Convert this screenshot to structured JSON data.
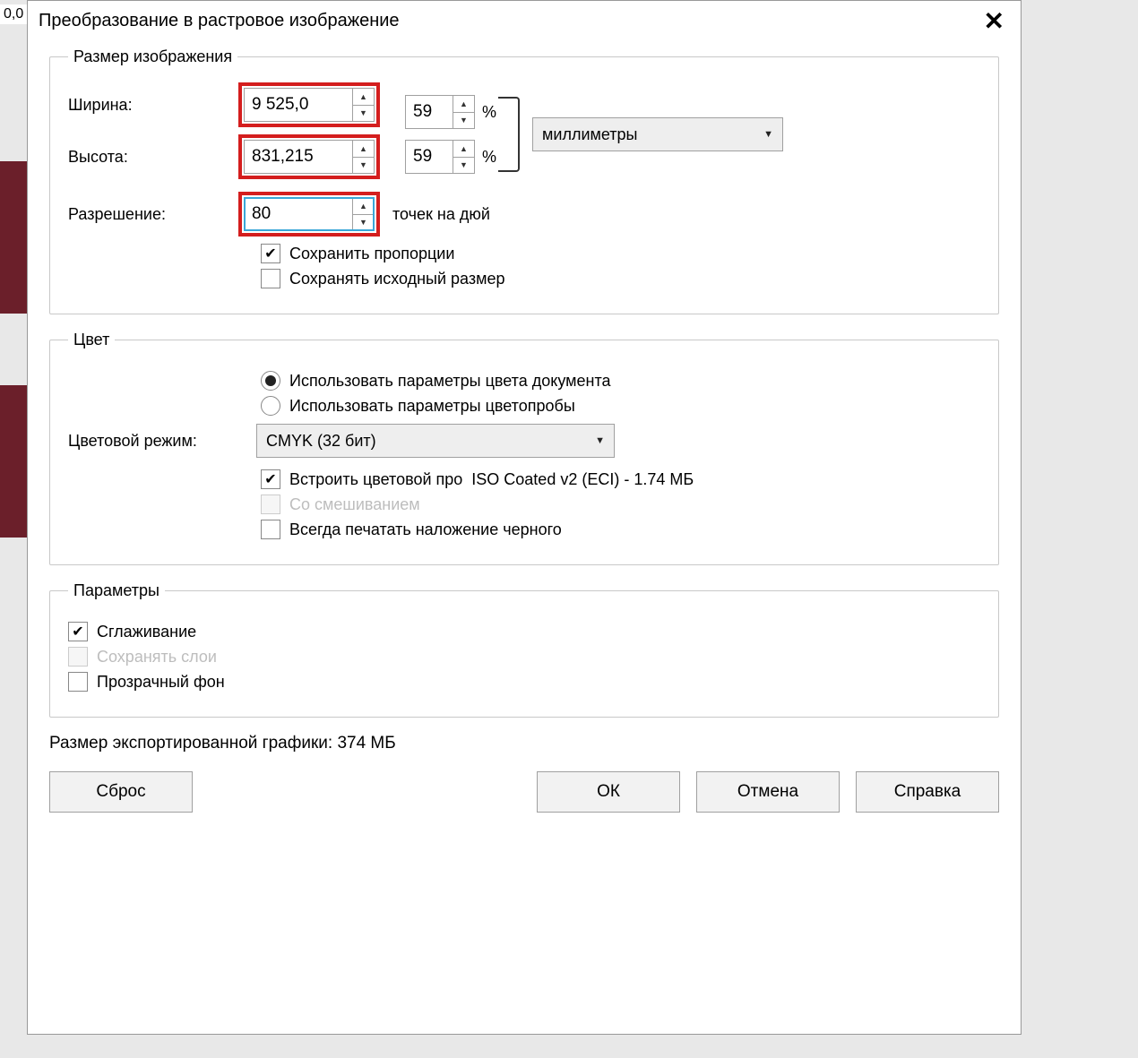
{
  "bgnum": "0,0",
  "dialog": {
    "title": "Преобразование в растровое изображение"
  },
  "size": {
    "legend": "Размер изображения",
    "width_label": "Ширина:",
    "width_value": "9 525,0",
    "width_pct": "59",
    "height_label": "Высота:",
    "height_value": "831,215",
    "height_pct": "59",
    "pct_symbol": "%",
    "unit_selected": "миллиметры",
    "resolution_label": "Разрешение:",
    "resolution_value": "80",
    "resolution_unit": "точек на дюй",
    "keep_aspect": "Сохранить пропорции",
    "keep_original": "Сохранять исходный размер"
  },
  "color": {
    "legend": "Цвет",
    "use_doc": "Использовать параметры цвета документа",
    "use_proof": "Использовать параметры цветопробы",
    "mode_label": "Цветовой режим:",
    "mode_value": "CMYK (32 бит)",
    "embed_profile": "Встроить цветовой про",
    "profile_name": "ISO Coated v2 (ECI) - 1.74 МБ",
    "dither": "Со смешиванием",
    "overprint": "Всегда печатать наложение черного"
  },
  "params": {
    "legend": "Параметры",
    "antialias": "Сглаживание",
    "layers": "Сохранять слои",
    "transparent": "Прозрачный фон"
  },
  "export_size": "Размер экспортированной графики: 374 МБ",
  "buttons": {
    "reset": "Сброс",
    "ok": "ОК",
    "cancel": "Отмена",
    "help": "Справка"
  }
}
